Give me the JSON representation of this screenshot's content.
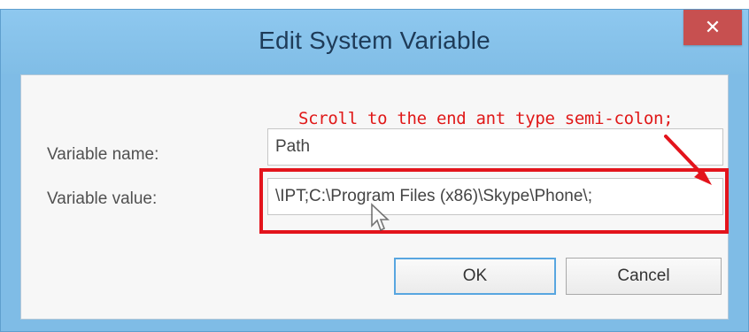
{
  "window": {
    "title": "Edit System Variable",
    "close_glyph": "✕"
  },
  "form": {
    "name_label": "Variable name:",
    "name_value": "Path",
    "value_label": "Variable value:",
    "value_value": "\\IPT;C:\\Program Files (x86)\\Skype\\Phone\\;"
  },
  "annotation": {
    "text": "Scroll to the end ant type semi-colon;",
    "color": "#e3141c"
  },
  "buttons": {
    "ok_label": "OK",
    "cancel_label": "Cancel"
  },
  "icons": {
    "close": "close-icon",
    "pointer": "mouse-pointer-icon",
    "arrow": "annotation-arrow"
  }
}
